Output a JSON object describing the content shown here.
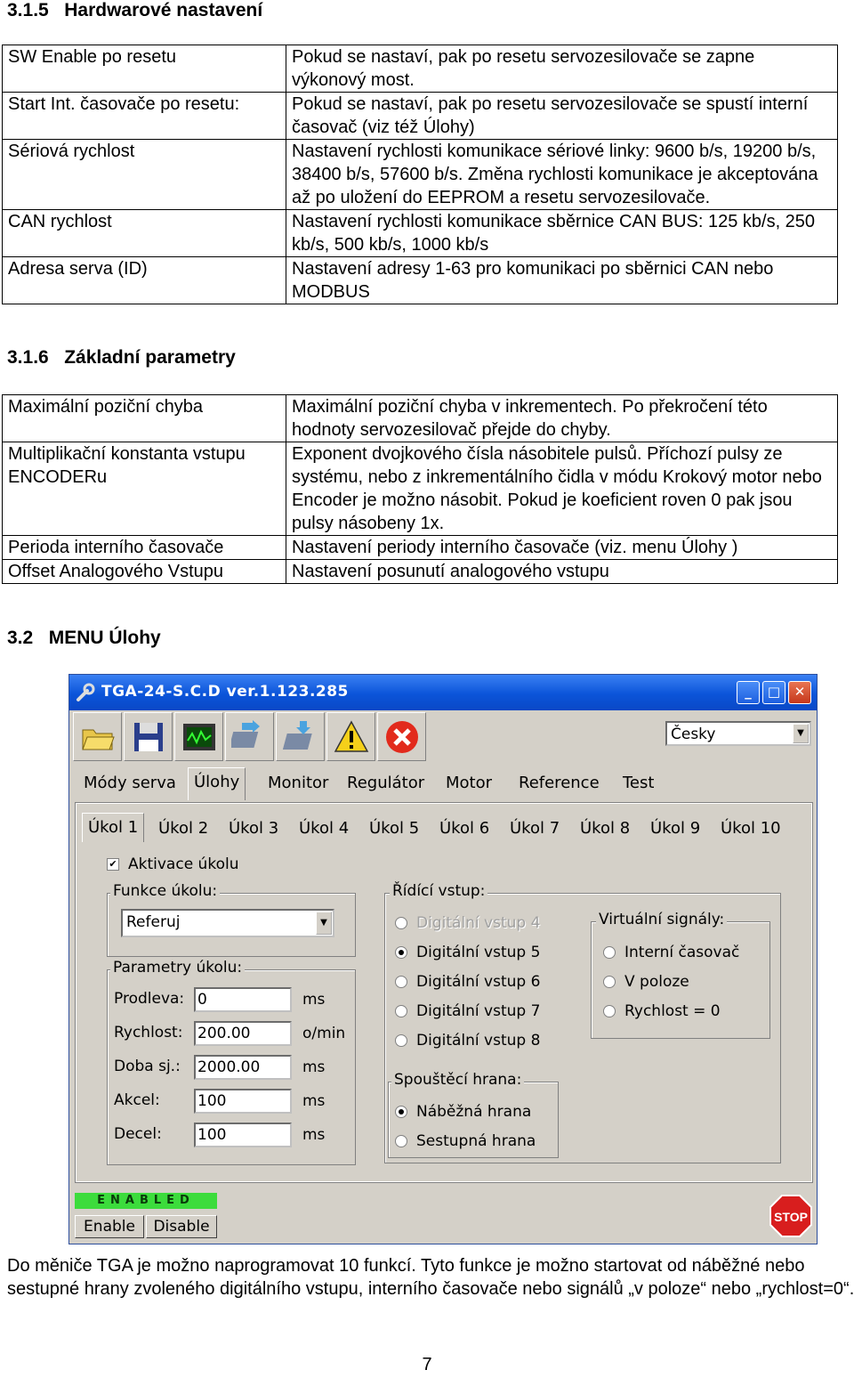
{
  "sec315": {
    "num": "3.1.5",
    "title": "Hardwarové nastavení"
  },
  "table1": [
    {
      "label": "SW Enable po resetu",
      "desc": "Pokud se nastaví, pak po resetu  servozesilovače se zapne výkonový most."
    },
    {
      "label": "Start Int. časovače po resetu:",
      "desc": "Pokud se nastaví, pak po resetu servozesilovače se spustí interní časovač (viz též Úlohy)"
    },
    {
      "label": "Sériová rychlost",
      "desc": "Nastavení rychlosti komunikace sériové linky: 9600 b/s, 19200 b/s, 38400 b/s, 57600 b/s. Změna rychlosti komunikace je  akceptována až po uložení do EEPROM a resetu servozesilovače."
    },
    {
      "label": "CAN rychlost",
      "desc": "Nastavení rychlosti komunikace sběrnice CAN BUS: 125 kb/s, 250 kb/s, 500 kb/s, 1000 kb/s"
    },
    {
      "label": "Adresa serva (ID)",
      "desc": "Nastavení adresy 1-63 pro komunikaci po sběrnici CAN nebo MODBUS"
    }
  ],
  "sec316": {
    "num": "3.1.6",
    "title": "Základní parametry"
  },
  "table2": [
    {
      "label": "Maximální poziční chyba",
      "desc": "Maximální poziční chyba v inkrementech. Po překročení této hodnoty servozesilovač přejde do chyby."
    },
    {
      "label": "Multiplikační konstanta vstupu ENCODERu",
      "desc": "Exponent dvojkového čísla násobitele pulsů. Příchozí pulsy ze systému, nebo z inkrementálního čidla v módu Krokový motor nebo Encoder je možno násobit. Pokud je koeficient roven 0 pak jsou pulsy násobeny 1x."
    },
    {
      "label": "Perioda interního časovače",
      "desc": "Nastavení periody interního časovače (viz. menu Úlohy )"
    },
    {
      "label": "Offset Analogového Vstupu",
      "desc": "Nastavení posunutí analogového vstupu"
    }
  ],
  "sec32": {
    "num": "3.2",
    "title": "MENU Úlohy"
  },
  "app": {
    "title": "TGA-24-S.C.D  ver.1.123.285",
    "language": "Česky",
    "main_tabs": [
      "Módy serva",
      "Úlohy",
      "Monitor",
      "Regulátor",
      "Motor",
      "Reference",
      "Test"
    ],
    "task_tabs": [
      "Úkol 1",
      "Úkol 2",
      "Úkol 3",
      "Úkol 4",
      "Úkol 5",
      "Úkol 6",
      "Úkol 7",
      "Úkol 8",
      "Úkol 9",
      "Úkol 10"
    ],
    "activate": "Aktivace úkolu",
    "funkce_label": "Funkce úkolu:",
    "funkce_value": "Referuj",
    "params_label": "Parametry úkolu:",
    "params": [
      {
        "label": "Prodleva:",
        "value": "0",
        "unit": "ms"
      },
      {
        "label": "Rychlost:",
        "value": "200.00",
        "unit": "o/min"
      },
      {
        "label": "Doba sj.:",
        "value": "2000.00",
        "unit": "ms"
      },
      {
        "label": "Akcel:",
        "value": "100",
        "unit": "ms"
      },
      {
        "label": "Decel:",
        "value": "100",
        "unit": "ms"
      }
    ],
    "ridici_label": "Řídící vstup:",
    "ridici": [
      "Digitální vstup 4",
      "Digitální vstup 5",
      "Digitální vstup 6",
      "Digitální vstup 7",
      "Digitální vstup 8"
    ],
    "virt_label": "Virtuální signály:",
    "virt": [
      "Interní časovač",
      "V poloze",
      "Rychlost = 0"
    ],
    "hrana_label": "Spouštěcí hrana:",
    "hrana": [
      "Náběžná hrana",
      "Sestupná hrana"
    ],
    "status": "ENABLED",
    "enable_btn": "Enable",
    "disable_btn": "Disable",
    "stop": "STOP",
    "colors": {
      "title_bar": "#0b54d9",
      "status_green": "#3cdc3c",
      "stop_red": "#d81e1e",
      "window_bg": "#d4d0c8"
    }
  },
  "paragraph": "Do měniče TGA je možno naprogramovat 10 funkcí. Tyto funkce je možno startovat od náběžné nebo sestupné hrany  zvoleného digitálního vstupu, interního časovače nebo  signálů „v poloze“ nebo „rychlost=0“.",
  "page_number": "7"
}
